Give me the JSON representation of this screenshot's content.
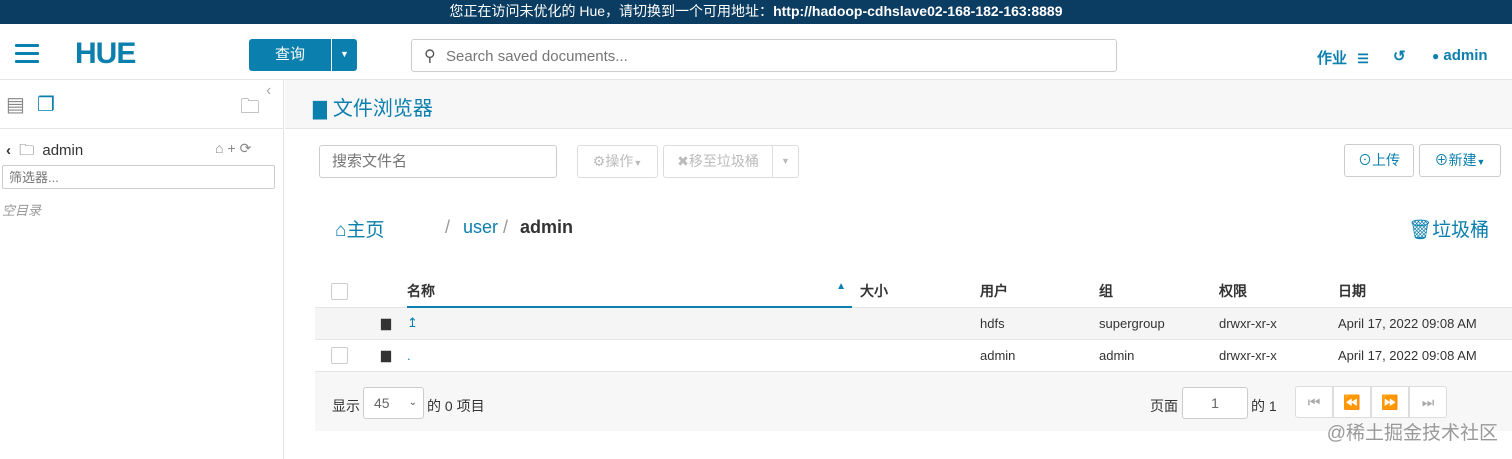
{
  "banner": {
    "prefix": "您正在访问未优化的 Hue，请切换到一个可用地址：",
    "url": "http://hadoop-cdhslave02-168-182-163:8889"
  },
  "topnav": {
    "logo": "HUE",
    "query_label": "查询",
    "search_placeholder": "Search saved documents...",
    "jobs_label": "作业",
    "user_label": "admin"
  },
  "sidebar": {
    "path_label": "admin",
    "filter_placeholder": "筛选器...",
    "empty_label": "空目录"
  },
  "page": {
    "title": "文件浏览器",
    "file_search_placeholder": "搜索文件名",
    "actions_label": "操作",
    "move_trash_label": "移至垃圾桶",
    "upload_label": "上传",
    "new_label": "新建",
    "breadcrumb": {
      "home": "主页",
      "user": "user",
      "current": "admin",
      "sep": "/"
    },
    "trash_label": "垃圾桶"
  },
  "table": {
    "headers": {
      "name": "名称",
      "size": "大小",
      "user": "用户",
      "group": "组",
      "perms": "权限",
      "date": "日期"
    },
    "rows": [
      {
        "name": "↥",
        "size": "",
        "user": "hdfs",
        "group": "supergroup",
        "perms": "drwxr-xr-x",
        "date": "April 17, 2022 09:08 AM"
      },
      {
        "name": ".",
        "size": "",
        "user": "admin",
        "group": "admin",
        "perms": "drwxr-xr-x",
        "date": "April 17, 2022 09:08 AM"
      }
    ]
  },
  "footer": {
    "show_label": "显示",
    "per_page": "45",
    "items_label": "的 0 项目",
    "page_label": "页面",
    "page_value": "1",
    "of_label": "的 1"
  },
  "watermark": "@稀土掘金技术社区",
  "colors": {
    "accent": "#0b7fad",
    "banner": "#0b3c61"
  }
}
